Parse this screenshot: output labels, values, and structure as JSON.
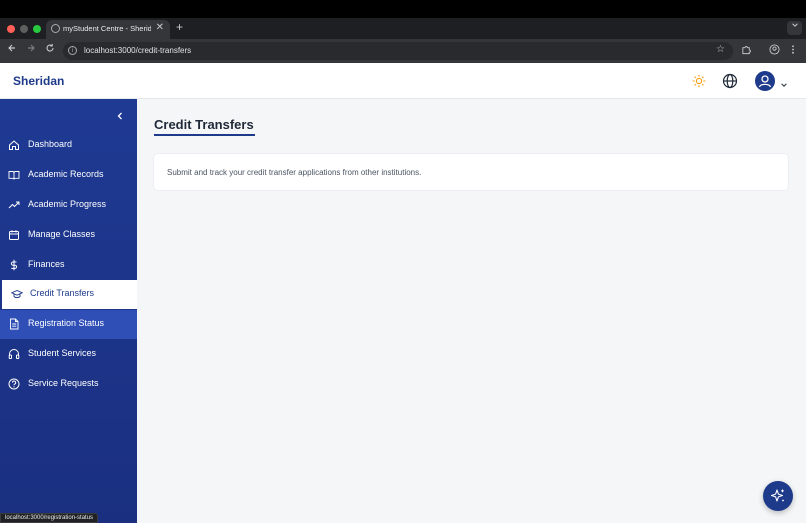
{
  "browser": {
    "tab_title": "myStudent Centre - Sheridan",
    "url": "localhost:3000/credit-transfers",
    "new_tab_label": "+",
    "close_tab_label": "✕"
  },
  "header": {
    "brand": "Sheridan"
  },
  "sidebar": {
    "items": [
      {
        "label": "Dashboard",
        "icon": "home-icon"
      },
      {
        "label": "Academic Records",
        "icon": "book-icon"
      },
      {
        "label": "Academic Progress",
        "icon": "trending-up-icon"
      },
      {
        "label": "Manage Classes",
        "icon": "calendar-icon"
      },
      {
        "label": "Finances",
        "icon": "dollar-icon"
      },
      {
        "label": "Credit Transfers",
        "icon": "graduation-cap-icon",
        "active": true
      },
      {
        "label": "Registration Status",
        "icon": "document-icon",
        "hover": true
      },
      {
        "label": "Student Services",
        "icon": "headphones-icon"
      },
      {
        "label": "Service Requests",
        "icon": "help-circle-icon"
      }
    ]
  },
  "main": {
    "title": "Credit Transfers",
    "description": "Submit and track your credit transfer applications from other institutions."
  },
  "status_url": "localhost:3000/registration-status",
  "colors": {
    "brand": "#1e3a8a",
    "sidebar": "#1f3a93",
    "sun_accent": "#f59e0b"
  }
}
